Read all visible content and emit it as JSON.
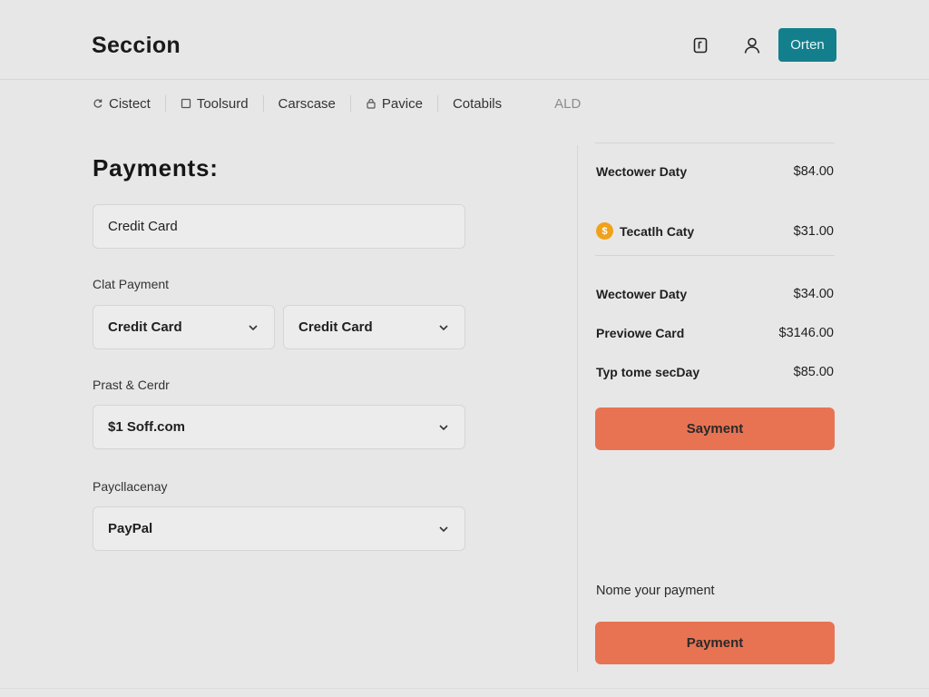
{
  "header": {
    "brand": "Seccion",
    "icons": [
      "bookmark-icon",
      "user-icon"
    ],
    "order_button": "Orten",
    "accent_color": "#137f8c"
  },
  "nav": {
    "items": [
      {
        "label": "Cistect",
        "icon": "refresh-icon"
      },
      {
        "label": "Toolsurd",
        "icon": "square-icon"
      },
      {
        "label": "Carscase",
        "icon": ""
      },
      {
        "label": "Pavice",
        "icon": "lock-icon"
      },
      {
        "label": "Cotabils",
        "icon": ""
      }
    ],
    "trailing": "ALD"
  },
  "payments": {
    "title": "Payments:",
    "method_field": "Credit Card",
    "clat_label": "Clat Payment",
    "select_left": "Credit Card",
    "select_right": "Credit Card",
    "prast_label": "Prast & Cerdr",
    "amount_select": "$1 Soff.com",
    "pay_label": "Paycllacenay",
    "paypal_select": "PayPal"
  },
  "summary": {
    "rows": [
      {
        "name": "Wectower Daty",
        "amount": "$84.00"
      },
      {
        "name": "Tecatlh Caty",
        "amount": "$31.00",
        "icon": "coin-icon"
      },
      {
        "name": "Wectower Daty",
        "amount": "$34.00"
      },
      {
        "name": "Previowe Card",
        "amount": "$3146.00"
      },
      {
        "name": "Typ tome secDay",
        "amount": "$85.00"
      }
    ],
    "button_top": "Sayment",
    "note": "Nome your payment",
    "button_bottom": "Payment",
    "button_color": "#e87352"
  }
}
